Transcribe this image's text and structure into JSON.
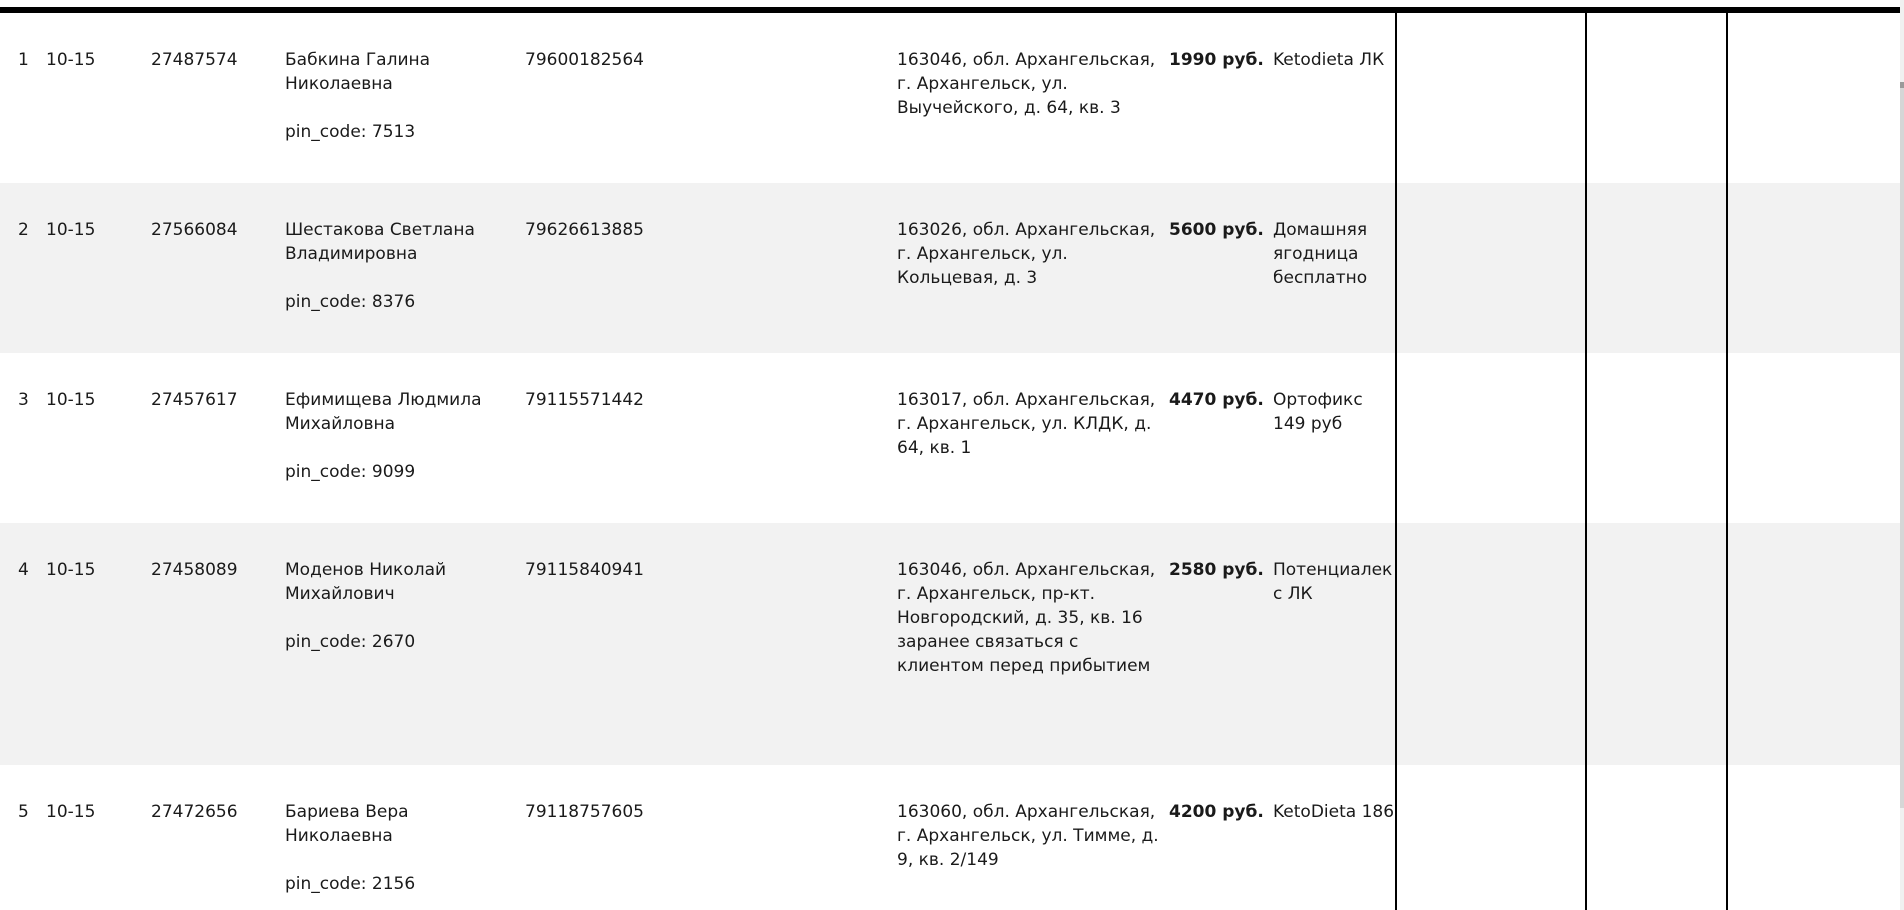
{
  "orders": {
    "rows": [
      {
        "num": "1",
        "time": "10-15",
        "order_id": "27487574",
        "name": "Бабкина Галина Николаевна",
        "pin": "pin_code: 7513",
        "phone": "79600182564",
        "address": "163046, обл. Архангельская, г. Архангельск, ул. Выучейского, д. 64, кв. 3",
        "price": "1990 руб.",
        "product": "Ketodieta ЛК"
      },
      {
        "num": "2",
        "time": "10-15",
        "order_id": "27566084",
        "name": "Шестакова Светлана Владимировна",
        "pin": "pin_code: 8376",
        "phone": "79626613885",
        "address": "163026, обл. Архангельская, г. Архангельск, ул. Кольцевая, д. 3",
        "price": "5600 руб.",
        "product": "Домашняя ягодница бесплатно"
      },
      {
        "num": "3",
        "time": "10-15",
        "order_id": "27457617",
        "name": "Ефимищева Людмила Михайловна",
        "pin": "pin_code: 9099",
        "phone": "79115571442",
        "address": "163017, обл. Архангельская, г. Архангельск, ул. КЛДК, д. 64, кв. 1",
        "price": "4470 руб.",
        "product": "Ортофикс 149 руб"
      },
      {
        "num": "4",
        "time": "10-15",
        "order_id": "27458089",
        "name": "Моденов Николай Михайлович",
        "pin": "pin_code: 2670",
        "phone": "79115840941",
        "address": "163046, обл. Архангельская, г. Архангельск, пр-кт. Новгородский, д. 35, кв. 16 заранее связаться с клиентом перед прибытием",
        "price": "2580 руб.",
        "product": "Потенциалекс ЛК"
      },
      {
        "num": "5",
        "time": "10-15",
        "order_id": "27472656",
        "name": "Бариева Вера Николаевна",
        "pin": "pin_code: 2156",
        "phone": "79118757605",
        "address": "163060, обл. Архангельская, г. Архангельск, ул. Тимме, д. 9, кв. 2/149",
        "price": "4200 руб.",
        "product": "KetoDieta 186"
      }
    ]
  }
}
